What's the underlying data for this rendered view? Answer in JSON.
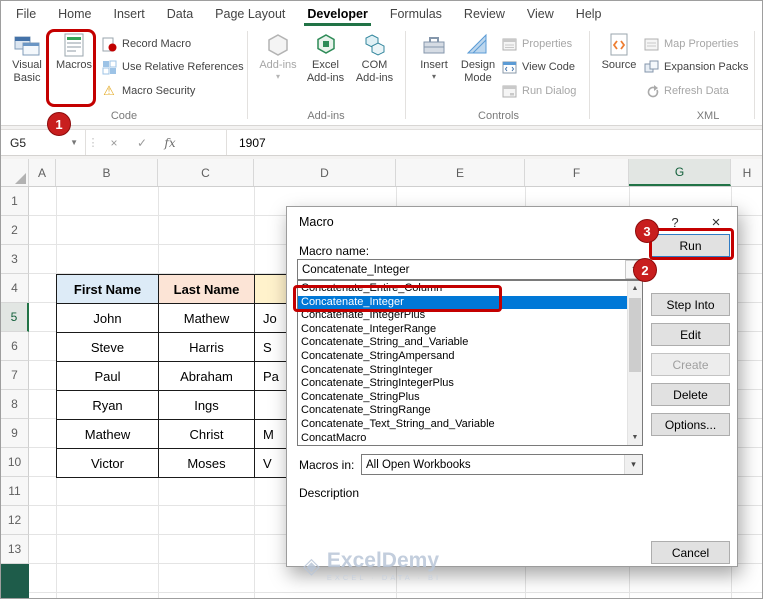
{
  "colors": {
    "accent_green": "#217346",
    "annotation_red": "#C40000",
    "selection_blue": "#0078D7",
    "header_blue_fill": "#DDEBF7",
    "header_orange_fill": "#FCE4D6",
    "header_yellow_fill": "#FFF2CC"
  },
  "icons": {
    "dropdown_arrow": "▾",
    "name_box_arrow": "▼",
    "separator_dots": "⋮",
    "cancel_x": "×",
    "check": "✓",
    "fx": "fx",
    "warning": "⚠",
    "spin_up": "↑",
    "scroll_up": "▲",
    "scroll_down": "▼",
    "help": "?",
    "close_x": "×",
    "watermark_diamond": "◈"
  },
  "ribbon": {
    "tabs": [
      {
        "label": "File",
        "active": false
      },
      {
        "label": "Home",
        "active": false
      },
      {
        "label": "Insert",
        "active": false
      },
      {
        "label": "Data",
        "active": false
      },
      {
        "label": "Page Layout",
        "active": false
      },
      {
        "label": "Developer",
        "active": true
      },
      {
        "label": "Formulas",
        "active": false
      },
      {
        "label": "Review",
        "active": false
      },
      {
        "label": "View",
        "active": false
      },
      {
        "label": "Help",
        "active": false
      }
    ],
    "code": {
      "label": "Code",
      "visual_basic": "Visual Basic",
      "macros": "Macros",
      "record_macro": "Record Macro",
      "use_relative_references": "Use Relative References",
      "macro_security": "Macro Security"
    },
    "addins": {
      "label": "Add-ins",
      "addins_button": "Add-ins",
      "excel_addins": "Excel Add-ins",
      "com_addins": "COM Add-ins"
    },
    "controls": {
      "label": "Controls",
      "insert": "Insert",
      "design_mode": "Design Mode",
      "properties": "Properties",
      "view_code": "View Code",
      "run_dialog": "Run Dialog"
    },
    "xml": {
      "label": "XML",
      "source": "Source",
      "map_properties": "Map Properties",
      "expansion_packs": "Expansion Packs",
      "refresh_data": "Refresh Data"
    }
  },
  "formula_bar": {
    "cell_reference": "G5",
    "value": "1907"
  },
  "sheet": {
    "columns": [
      "A",
      "B",
      "C",
      "D",
      "E",
      "F",
      "G",
      "H"
    ],
    "rows": [
      "1",
      "2",
      "3",
      "4",
      "5",
      "6",
      "7",
      "8",
      "9",
      "10",
      "11",
      "12",
      "13"
    ],
    "selected_column": "G",
    "selected_row": "5",
    "table": {
      "headers": [
        "First Name",
        "Last Name"
      ],
      "data": [
        [
          "John",
          "Mathew",
          "Jo"
        ],
        [
          "Steve",
          "Harris",
          "S"
        ],
        [
          "Paul",
          "Abraham",
          "Pa"
        ],
        [
          "Ryan",
          "Ings",
          ""
        ],
        [
          "Mathew",
          "Christ",
          "M"
        ],
        [
          "Victor",
          "Moses",
          "V"
        ]
      ]
    }
  },
  "dialog": {
    "title": "Macro",
    "macro_name_label": "Macro name:",
    "macro_name_value": "Concatenate_Integer",
    "macro_list": [
      "Concatenate_Entire_Column",
      "Concatenate_Integer",
      "Concatenate_IntegerPlus",
      "Concatenate_IntegerRange",
      "Concatenate_String_and_Variable",
      "Concatenate_StringAmpersand",
      "Concatenate_StringInteger",
      "Concatenate_StringIntegerPlus",
      "Concatenate_StringPlus",
      "Concatenate_StringRange",
      "Concatenate_Text_String_and_Variable",
      "ConcatMacro"
    ],
    "selected_macro": "Concatenate_Integer",
    "macros_in_label": "Macros in:",
    "macros_in_value": "All Open Workbooks",
    "description_label": "Description",
    "buttons": {
      "run": "Run",
      "step_into": "Step Into",
      "edit": "Edit",
      "create": "Create",
      "delete": "Delete",
      "options": "Options...",
      "cancel": "Cancel"
    }
  },
  "annotations": {
    "step_1": "1",
    "step_2": "2",
    "step_3": "3"
  },
  "watermark": {
    "name": "ExcelDemy",
    "tagline": "EXCEL · DATA · BI"
  }
}
